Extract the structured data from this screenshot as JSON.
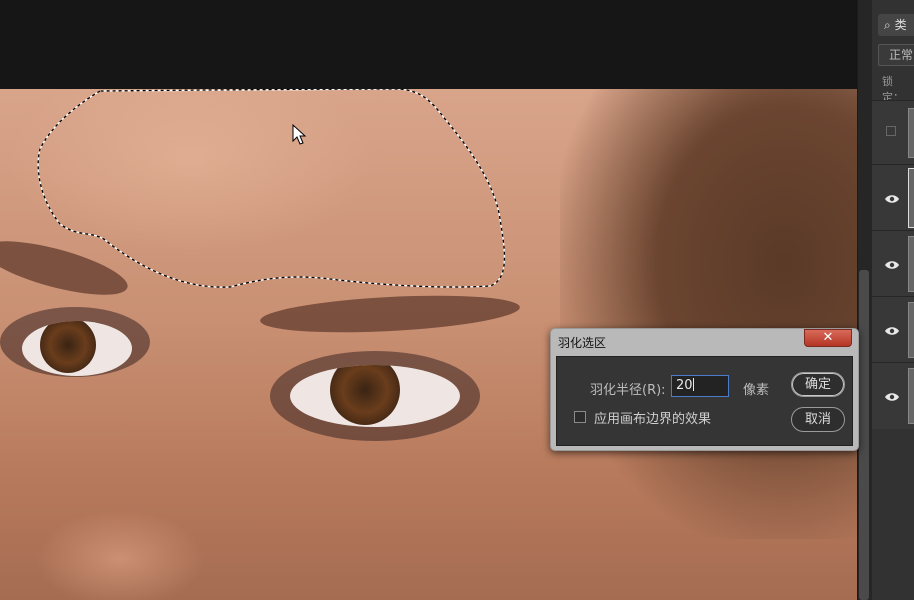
{
  "dialog": {
    "title": "羽化选区",
    "close_symbol": "✕",
    "radius_label": "羽化半径(R):",
    "radius_value": "20",
    "unit": "像素",
    "checkbox_label": "应用画布边界的效果",
    "checkbox_checked": false,
    "ok_label": "确定",
    "cancel_label": "取消"
  },
  "layers_panel": {
    "search_icon": "search-icon",
    "search_text": "类",
    "blend_mode": "正常",
    "lock_label": "锁定："
  }
}
